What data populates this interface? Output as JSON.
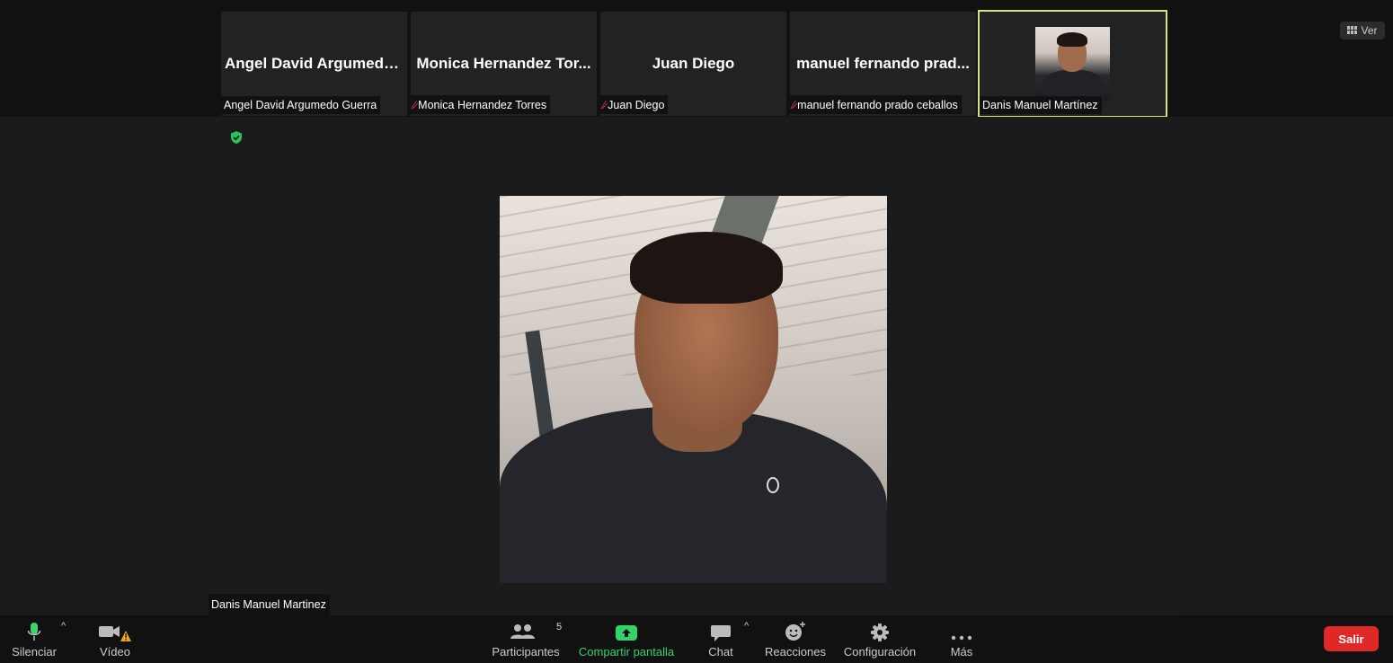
{
  "view_button": {
    "label": "Ver"
  },
  "participants_strip": [
    {
      "display_name": "Angel David Argumedo...",
      "tag": "Angel David Argumedo Guerra",
      "muted": false
    },
    {
      "display_name": "Monica Hernandez Tor...",
      "tag": "Monica Hernandez Torres",
      "muted": true
    },
    {
      "display_name": "Juan Diego",
      "tag": "Juan Diego",
      "muted": true
    },
    {
      "display_name": "manuel fernando prad...",
      "tag": "manuel fernando prado ceballos",
      "muted": true
    },
    {
      "display_name": "",
      "tag": "Danis Manuel Martínez",
      "muted": false,
      "active_speaker": true
    }
  ],
  "main_video": {
    "name_tag": "Danis Manuel Martinez"
  },
  "toolbar": {
    "mute": "Silenciar",
    "video": "Vídeo",
    "participants": "Participantes",
    "participants_count": "5",
    "share": "Compartir pantalla",
    "chat": "Chat",
    "reactions": "Reacciones",
    "settings": "Configuración",
    "more": "Más",
    "leave": "Salir"
  },
  "colors": {
    "share_green": "#31d46b",
    "leave_red": "#e02828",
    "active_border": "#d9e27c",
    "shield_green": "#2bc15a",
    "mute_red": "#e0314a"
  }
}
